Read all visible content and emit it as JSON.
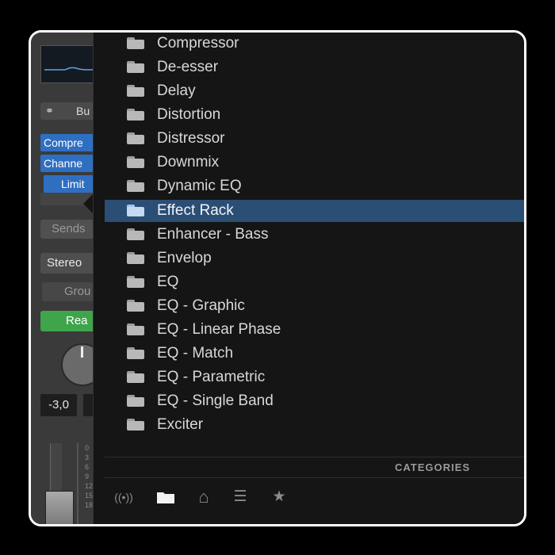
{
  "channel_strip": {
    "link_button_label": "Bu",
    "plugin_slots": [
      "Compre",
      "Channe",
      "Limit"
    ],
    "sends_label": "Sends",
    "output_label": "Stereo",
    "group_label": "Grou",
    "automation_label": "Rea",
    "volume_value": "-3,0",
    "fader_scale": [
      "0",
      "3",
      "6",
      "9",
      "12",
      "15",
      "18"
    ]
  },
  "popup_menu": {
    "items": [
      {
        "label": "Compressor",
        "selected": false
      },
      {
        "label": "De-esser",
        "selected": false
      },
      {
        "label": "Delay",
        "selected": false
      },
      {
        "label": "Distortion",
        "selected": false
      },
      {
        "label": "Distressor",
        "selected": false
      },
      {
        "label": "Downmix",
        "selected": false
      },
      {
        "label": "Dynamic EQ",
        "selected": false
      },
      {
        "label": "Effect Rack",
        "selected": true
      },
      {
        "label": "Enhancer - Bass",
        "selected": false
      },
      {
        "label": "Envelop",
        "selected": false
      },
      {
        "label": "EQ",
        "selected": false
      },
      {
        "label": "EQ - Graphic",
        "selected": false
      },
      {
        "label": "EQ - Linear Phase",
        "selected": false
      },
      {
        "label": "EQ - Match",
        "selected": false
      },
      {
        "label": "EQ - Parametric",
        "selected": false
      },
      {
        "label": "EQ - Single Band",
        "selected": false
      },
      {
        "label": "Exciter",
        "selected": false
      }
    ],
    "section_title": "CATEGORIES",
    "toolbar": [
      {
        "icon": "broadcast-icon",
        "glyph": "((•))",
        "active": false
      },
      {
        "icon": "folder-icon",
        "glyph": "",
        "active": true
      },
      {
        "icon": "home-icon",
        "glyph": "⌂",
        "active": false
      },
      {
        "icon": "list-icon",
        "glyph": "☰",
        "active": false
      },
      {
        "icon": "star-icon",
        "glyph": "★",
        "active": false
      }
    ]
  },
  "colors": {
    "selection": "#2b4e74",
    "plugin_slot": "#2f6fc2",
    "read_mode": "#3fa54b"
  }
}
